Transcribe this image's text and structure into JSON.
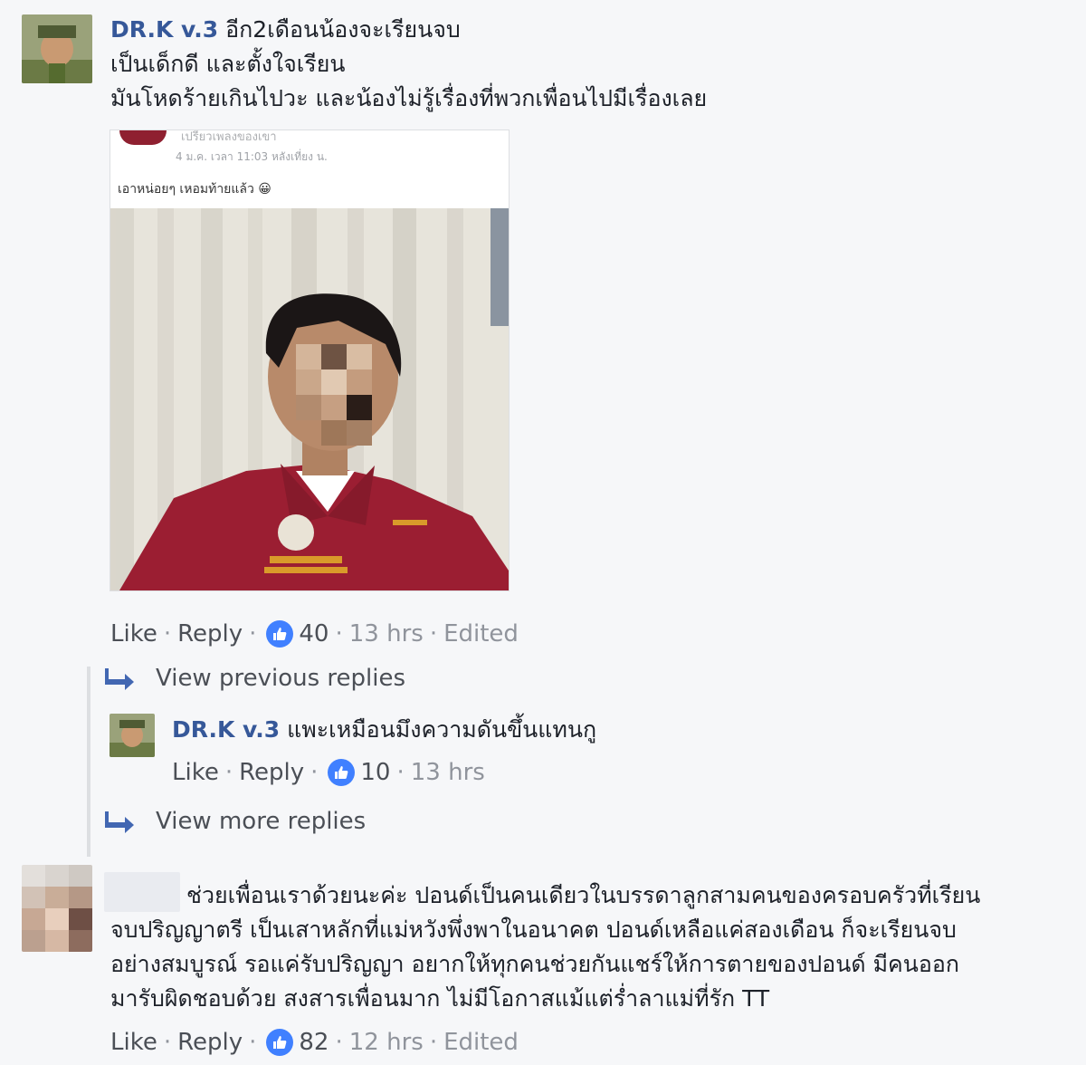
{
  "comments": [
    {
      "author": "DR.K v.3",
      "lines": [
        "อีก2เดือนน้องจะเรียนจบ",
        "เป็นเด็กดี และตั้งใจเรียน",
        "มันโหดร้ายเกินไปวะ และน้องไม่รู้เรื่องที่พวกเพื่อนไปมีเรื่องเลย"
      ],
      "embed": {
        "page_name": "เปรี้ยวเพลงของเขา",
        "meta": "4 ม.ค. เวลา 11:03 หลังเที่ยง น.",
        "caption": "เอาหน่อยๆ เหอมท้ายแล้ว 😀"
      },
      "actions": {
        "like": "Like",
        "reply": "Reply",
        "count": "40",
        "time": "13 hrs",
        "edited": "Edited"
      }
    },
    {
      "author": "",
      "lines": [
        "ช่วยเพื่อนเราด้วยนะค่ะ ปอนด์เป็นคนเดียวในบรรดาลูกสามคนของครอบครัวที่เรียน",
        "จบปริญญาตรี เป็นเสาหลักที่แม่หวังพึ่งพาในอนาคต ปอนด์เหลือแค่สองเดือน ก็จะเรียนจบ",
        "อย่างสมบูรณ์ รอแค่รับปริญญา อยากให้ทุกคนช่วยกันแชร์ให้การตายของปอนด์ มีคนออก",
        "มารับผิดชอบด้วย สงสารเพื่อนมาก ไม่มีโอกาสแม้แต่ร่ำลาแม่ที่รัก TT"
      ],
      "actions": {
        "like": "Like",
        "reply": "Reply",
        "count": "82",
        "time": "12 hrs",
        "edited": "Edited"
      }
    }
  ],
  "reply_thread": {
    "view_previous": "View previous replies",
    "view_more": "View more replies",
    "reply": {
      "author": "DR.K v.3",
      "text": "แพะเหมือนมึงความดันขึ้นแทนกู",
      "actions": {
        "like": "Like",
        "reply": "Reply",
        "count": "10",
        "time": "13 hrs"
      }
    }
  },
  "colors": {
    "name": "#365899",
    "like_badge": "#4080ff",
    "background": "#f6f7f9",
    "shirt": "#9b1e32"
  }
}
